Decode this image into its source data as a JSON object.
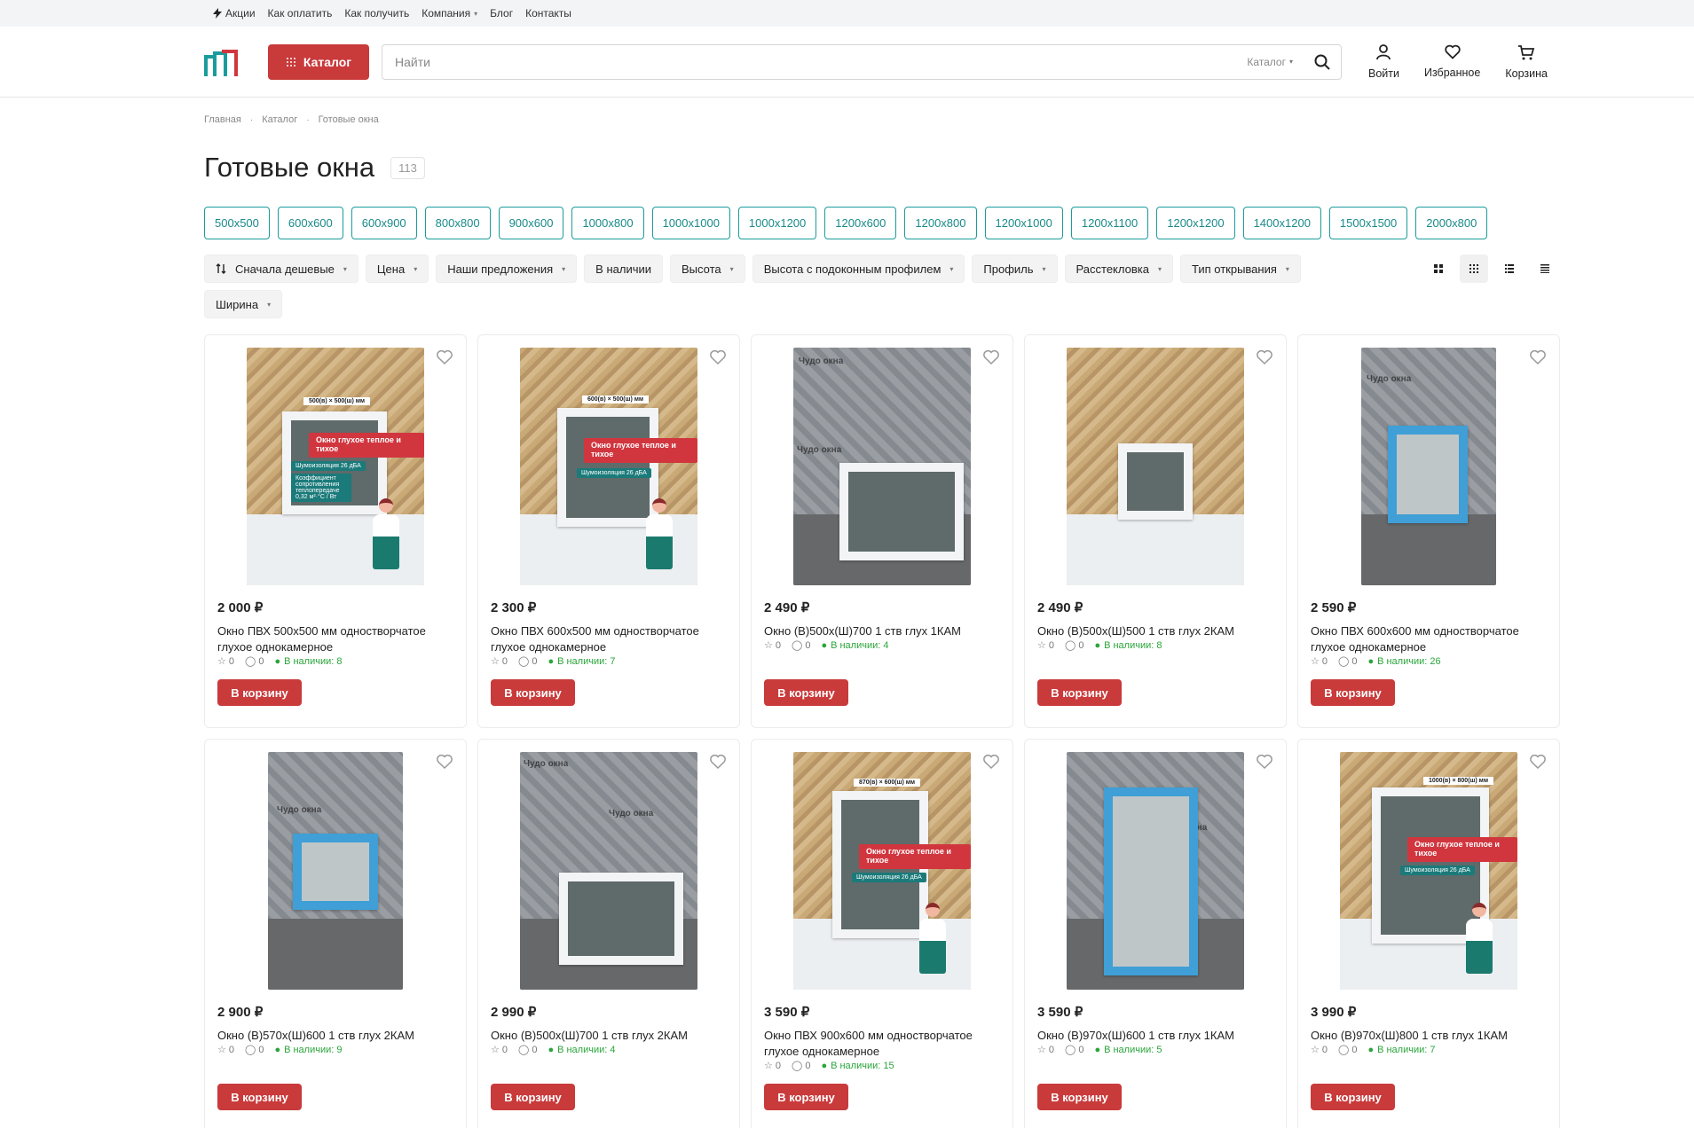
{
  "topbar": {
    "items": [
      "Акции",
      "Как оплатить",
      "Как получить",
      "Компания",
      "Блог",
      "Контакты"
    ]
  },
  "header": {
    "catalog_label": "Каталог",
    "search_placeholder": "Найти",
    "search_scope": "Каталог",
    "actions": [
      "Войти",
      "Избранное",
      "Корзина"
    ]
  },
  "colors": {
    "accent": "#c93a3b",
    "teal": "#1a9c9c",
    "stock": "#2aa53a",
    "logo_red": "#d1363f"
  },
  "breadcrumb": [
    "Главная",
    "Каталог",
    "Готовые окна"
  ],
  "page": {
    "title": "Готовые окна",
    "count": "113"
  },
  "size_tags": [
    "500x500",
    "600x600",
    "600x900",
    "800x800",
    "900x600",
    "1000x800",
    "1000x1000",
    "1000x1200",
    "1200x600",
    "1200x800",
    "1200x1000",
    "1200x1100",
    "1200x1200",
    "1400x1200",
    "1500x1500",
    "2000x800"
  ],
  "filters": [
    "Сначала дешевые",
    "Цена",
    "Наши предложения",
    "В наличии",
    "Высота",
    "Высота с подоконным профилем",
    "Профиль",
    "Расстекловка",
    "Тип открывания"
  ],
  "filters_row2": [
    "Ширина"
  ],
  "sticker_text": {
    "main": "Окно глухое теплое и тихое",
    "noise": "Шумоизоляция 26 дБА",
    "coef": "Коэффициент сопротивления теплопередаче 0,32 м²·°С / Вт"
  },
  "print_text": "Чудо окна",
  "products": [
    {
      "price": "2 000 ₽",
      "name": "Окно ПВХ 500х500 мм одностворчатое глухое однокамерное",
      "rating": "0",
      "reviews": "0",
      "stock": "В наличии: 8",
      "cart": "В корзину",
      "photo_label": "500(в) × 500(ш) мм"
    },
    {
      "price": "2 300 ₽",
      "name": "Окно ПВХ 600х500 мм одностворчатое глухое однокамерное",
      "rating": "0",
      "reviews": "0",
      "stock": "В наличии: 7",
      "cart": "В корзину",
      "photo_label": "600(в) × 500(ш) мм"
    },
    {
      "price": "2 490 ₽",
      "name": "Окно (В)500х(Ш)700 1 ств глух 1КАМ",
      "rating": "0",
      "reviews": "0",
      "stock": "В наличии: 4",
      "cart": "В корзину",
      "photo_label": ""
    },
    {
      "price": "2 490 ₽",
      "name": "Окно (В)500х(Ш)500 1 ств глух 2КАМ",
      "rating": "0",
      "reviews": "0",
      "stock": "В наличии: 8",
      "cart": "В корзину",
      "photo_label": ""
    },
    {
      "price": "2 590 ₽",
      "name": "Окно ПВХ 600х600 мм одностворчатое глухое однокамерное",
      "rating": "0",
      "reviews": "0",
      "stock": "В наличии: 26",
      "cart": "В корзину",
      "photo_label": ""
    },
    {
      "price": "2 900 ₽",
      "name": "Окно (В)570х(Ш)600 1 ств глух 2КАМ",
      "rating": "0",
      "reviews": "0",
      "stock": "В наличии: 9",
      "cart": "В корзину",
      "photo_label": ""
    },
    {
      "price": "2 990 ₽",
      "name": "Окно (В)500х(Ш)700 1 ств глух 2КАМ",
      "rating": "0",
      "reviews": "0",
      "stock": "В наличии: 4",
      "cart": "В корзину",
      "photo_label": ""
    },
    {
      "price": "3 590 ₽",
      "name": "Окно ПВХ 900х600 мм одностворчатое глухое однокамерное",
      "rating": "0",
      "reviews": "0",
      "stock": "В наличии: 15",
      "cart": "В корзину",
      "photo_label": "870(в) × 600(ш) мм"
    },
    {
      "price": "3 590 ₽",
      "name": "Окно (В)970х(Ш)600 1 ств глух 1КАМ",
      "rating": "0",
      "reviews": "0",
      "stock": "В наличии: 5",
      "cart": "В корзину",
      "photo_label": ""
    },
    {
      "price": "3 990 ₽",
      "name": "Окно (В)970х(Ш)800 1 ств глух 1КАМ",
      "rating": "0",
      "reviews": "0",
      "stock": "В наличии: 7",
      "cart": "В корзину",
      "photo_label": "1000(в) × 800(ш) мм"
    }
  ]
}
